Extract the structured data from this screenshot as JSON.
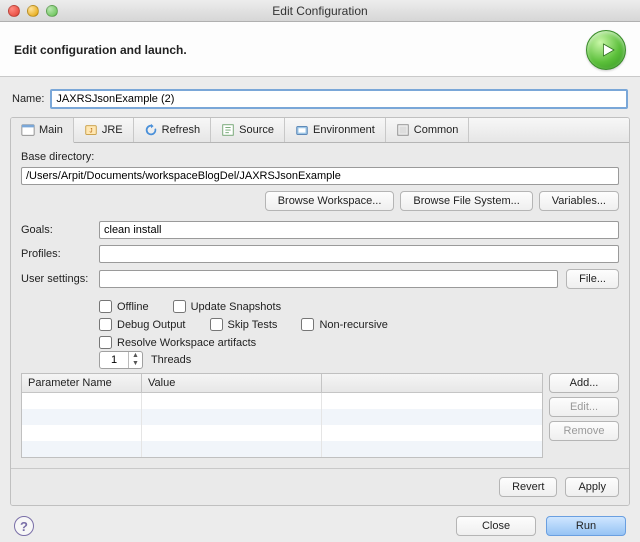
{
  "window": {
    "title": "Edit Configuration"
  },
  "header": {
    "title": "Edit configuration and launch."
  },
  "name": {
    "label": "Name:",
    "value": "JAXRSJsonExample (2)"
  },
  "tabs": {
    "main": "Main",
    "jre": "JRE",
    "refresh": "Refresh",
    "source": "Source",
    "environment": "Environment",
    "common": "Common"
  },
  "main": {
    "base_dir_label": "Base directory:",
    "base_dir_value": "/Users/Arpit/Documents/workspaceBlogDel/JAXRSJsonExample",
    "browse_ws": "Browse Workspace...",
    "browse_fs": "Browse File System...",
    "variables": "Variables...",
    "goals_label": "Goals:",
    "goals_value": "clean install",
    "profiles_label": "Profiles:",
    "profiles_value": "",
    "usersettings_label": "User settings:",
    "usersettings_value": "",
    "file_btn": "File...",
    "chk_offline": "Offline",
    "chk_update": "Update Snapshots",
    "chk_debug": "Debug Output",
    "chk_skip": "Skip Tests",
    "chk_nonrec": "Non-recursive",
    "chk_resolve": "Resolve Workspace artifacts",
    "threads_value": "1",
    "threads_label": "Threads",
    "table": {
      "col_name": "Parameter Name",
      "col_value": "Value"
    },
    "btn_add": "Add...",
    "btn_edit": "Edit...",
    "btn_remove": "Remove"
  },
  "panel_footer": {
    "revert": "Revert",
    "apply": "Apply"
  },
  "bottom": {
    "close": "Close",
    "run": "Run"
  },
  "help": "?"
}
